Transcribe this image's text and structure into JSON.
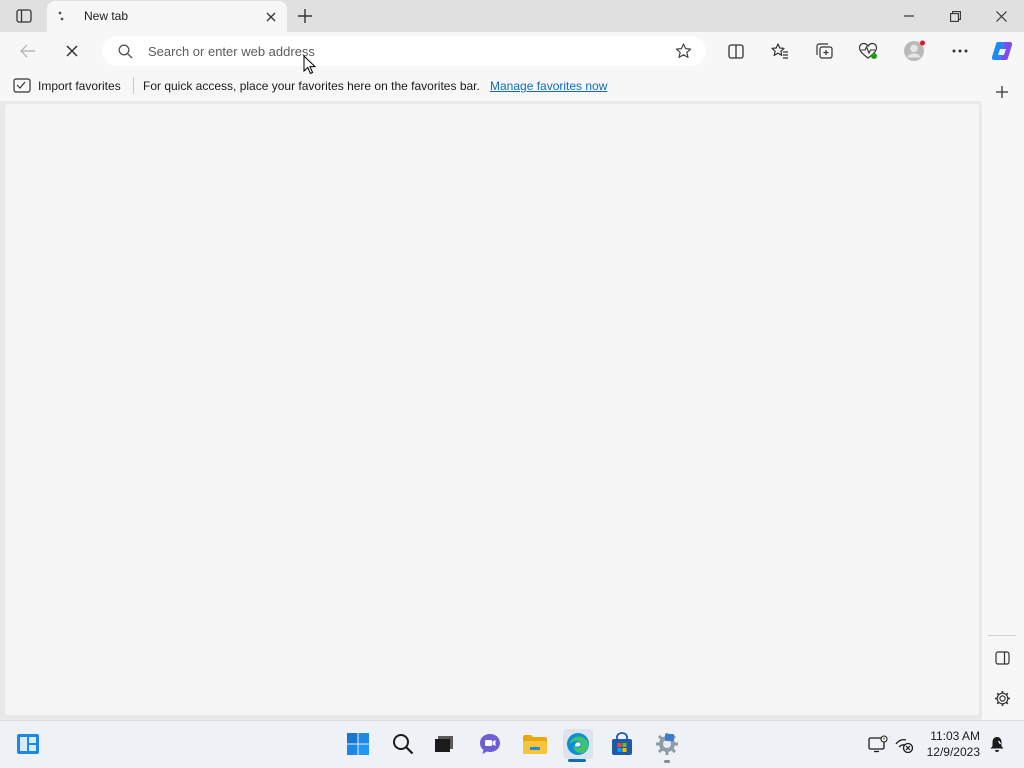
{
  "browser": {
    "tab": {
      "title": "New tab"
    },
    "omnibox": {
      "placeholder": "Search or enter web address"
    },
    "favorites_bar": {
      "import_label": "Import favorites",
      "message": "For quick access, place your favorites here on the favorites bar.",
      "manage_link": "Manage favorites now"
    },
    "icons": {
      "tab_actions": "tab-actions-icon",
      "loading": "loading-spinner-icon",
      "close_tab": "close-icon",
      "new_tab": "plus-icon",
      "minimize": "minimize-icon",
      "restore": "restore-icon",
      "close_window": "close-icon",
      "back": "back-arrow-icon",
      "stop": "stop-icon",
      "search": "search-icon",
      "favorite_star": "star-icon",
      "split_screen": "split-screen-icon",
      "favorites": "favorites-icon",
      "collections": "collections-icon",
      "browser_essentials": "heart-pulse-icon",
      "profile": "profile-avatar-icon",
      "more": "more-icon",
      "copilot": "copilot-icon"
    }
  },
  "taskbar": {
    "clock": {
      "time": "11:03 AM",
      "date": "12/9/2023"
    }
  },
  "colors": {
    "accent": "#0f6cbd",
    "titlebar": "#e0e0e0",
    "toolbar": "#f7f7f7",
    "content": "#f5f5f5"
  }
}
